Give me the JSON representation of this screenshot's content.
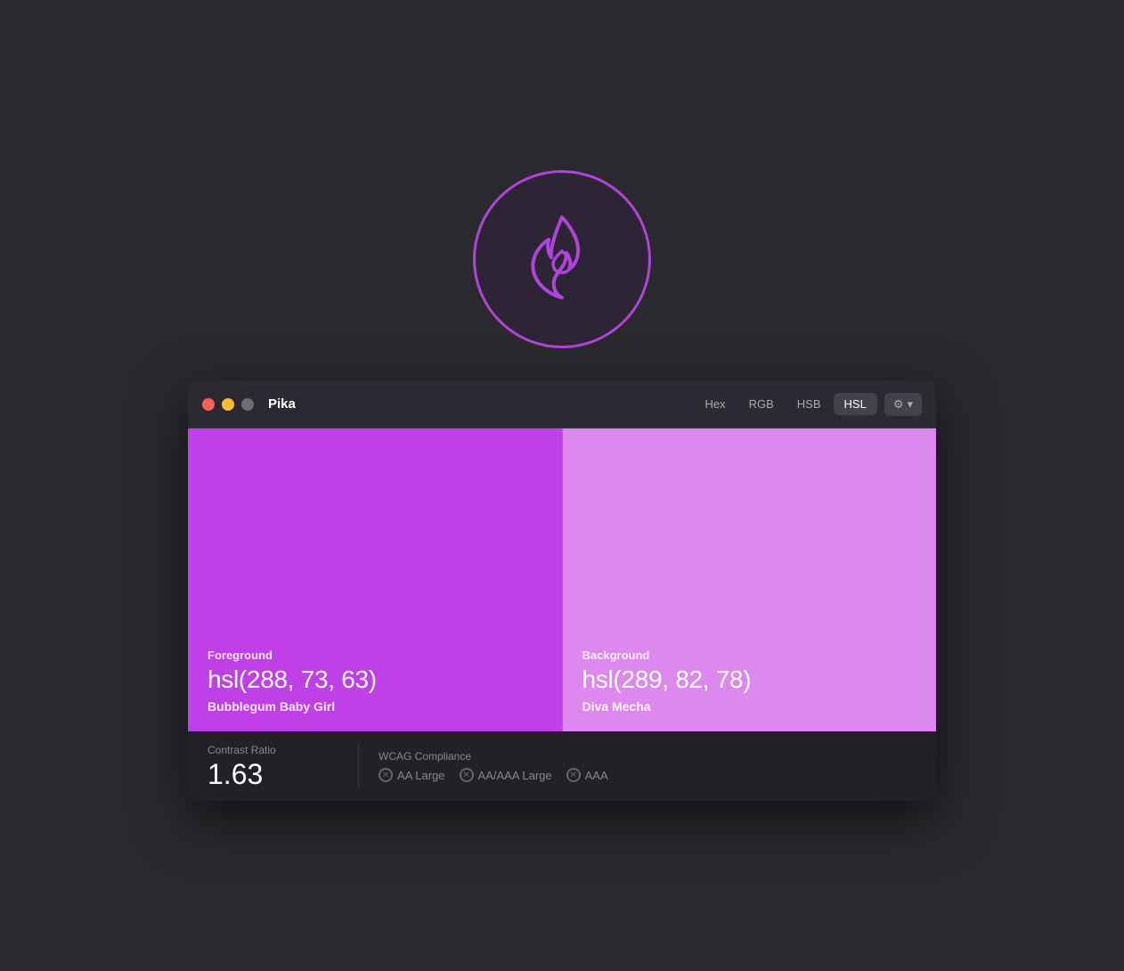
{
  "app_icon": {
    "label": "Pika App Icon"
  },
  "window": {
    "title": "Pika",
    "traffic_lights": {
      "red": "close",
      "yellow": "minimize",
      "gray": "fullscreen"
    },
    "format_tabs": [
      {
        "id": "hex",
        "label": "Hex",
        "active": false
      },
      {
        "id": "rgb",
        "label": "RGB",
        "active": false
      },
      {
        "id": "hsb",
        "label": "HSB",
        "active": false
      },
      {
        "id": "hsl",
        "label": "HSL",
        "active": true
      }
    ],
    "settings_label": "⚙",
    "chevron_label": "▾",
    "foreground": {
      "label": "Foreground",
      "value": "hsl(288, 73, 63)",
      "name": "Bubblegum Baby Girl",
      "color": "#c040e8"
    },
    "background": {
      "label": "Background",
      "value": "hsl(289, 82, 78)",
      "name": "Diva Mecha",
      "color": "#dd88ee"
    },
    "contrast": {
      "label": "Contrast Ratio",
      "value": "1.63"
    },
    "wcag": {
      "label": "WCAG Compliance",
      "badges": [
        {
          "id": "aa-large",
          "label": "AA Large"
        },
        {
          "id": "aa-aaa-large",
          "label": "AA/AAA Large"
        },
        {
          "id": "aaa",
          "label": "AAA"
        }
      ]
    }
  }
}
